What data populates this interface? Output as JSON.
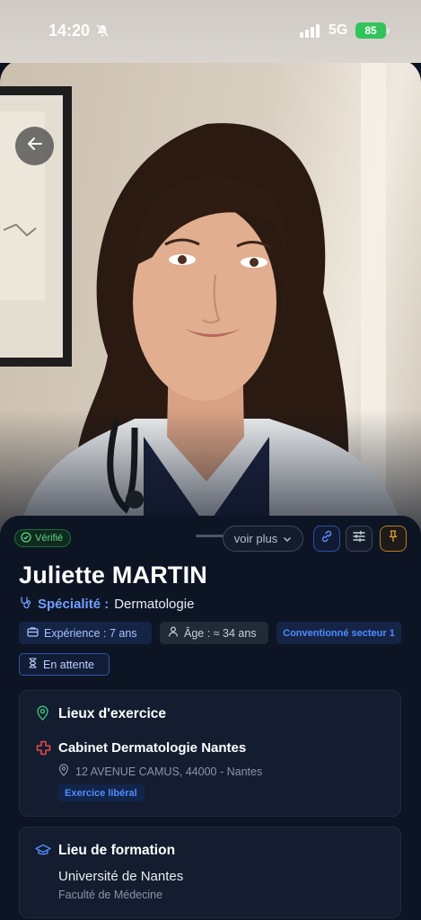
{
  "status_bar": {
    "time": "14:20",
    "network": "5G",
    "battery": "85"
  },
  "icons": {
    "back": "arrow-left-icon",
    "verified": "check-circle-icon",
    "link": "link-icon",
    "sliders": "sliders-icon",
    "pin": "pin-icon",
    "specialty": "stethoscope-icon",
    "experience": "briefcase-icon",
    "age": "person-icon",
    "pending": "hourglass-icon",
    "location": "map-pin-icon",
    "cabinet": "medical-cross-icon",
    "address": "map-pin-icon",
    "education": "graduation-cap-icon"
  },
  "profile": {
    "verified_label": "Vérifié",
    "voir_plus_label": "voir plus",
    "name": "Juliette MARTIN",
    "specialty_label": "Spécialité :",
    "specialty_value": "Dermatologie",
    "chips": {
      "experience": "Expérience : 7 ans",
      "age": "Âge : ≈ 34 ans",
      "convention": "Conventionné secteur 1",
      "status": "En attente"
    }
  },
  "lieux": {
    "title": "Lieux d'exercice",
    "cabinet_name": "Cabinet Dermatologie Nantes",
    "address": "12 AVENUE CAMUS, 44000 - Nantes",
    "badge": "Exercice libéral"
  },
  "formation": {
    "title": "Lieu de formation",
    "university": "Université de Nantes",
    "faculty": "Faculté de Médecine"
  },
  "colors": {
    "background": "#0d1525",
    "accent_blue": "#4f8bff",
    "verified_green": "#5fd48a",
    "pin_orange": "#e0a03a",
    "cross_red": "#e5484d"
  }
}
